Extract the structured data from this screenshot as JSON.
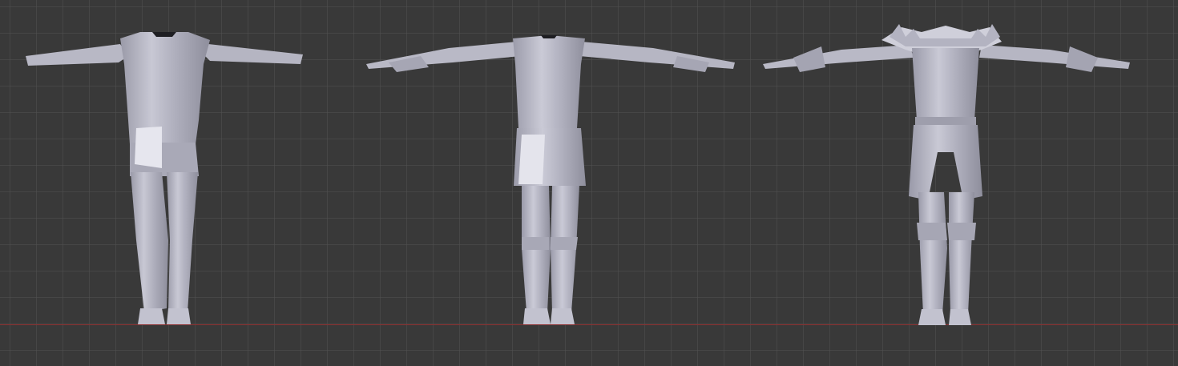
{
  "viewport": {
    "view": "front-orthographic",
    "background_color": "#393939",
    "grid_color": "#505050",
    "x_axis_color": "#8a2e2e"
  },
  "models": [
    {
      "id": "base-body",
      "variant": "plain",
      "material_color": "#b9b9c6"
    },
    {
      "id": "tunic-body",
      "variant": "tunic",
      "material_color": "#b9b9c6"
    },
    {
      "id": "armored-body",
      "variant": "armor",
      "material_color": "#b9b9c6"
    }
  ]
}
